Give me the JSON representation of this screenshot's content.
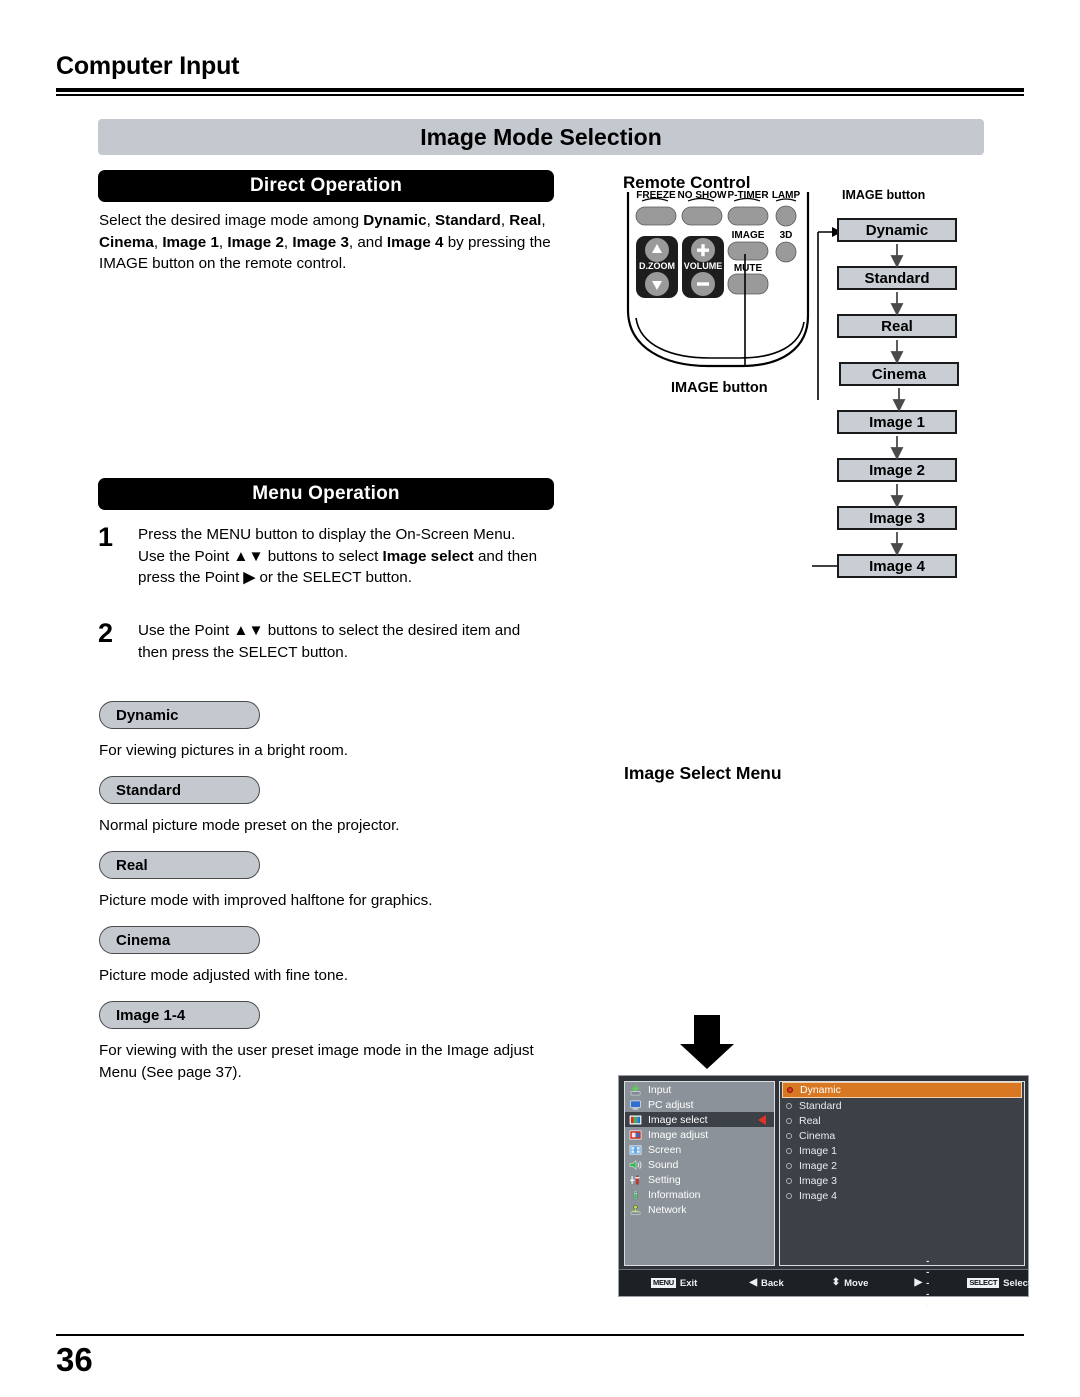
{
  "header": {
    "title": "Computer Input"
  },
  "section": {
    "title": "Image Mode Selection"
  },
  "direct_operation": {
    "heading": "Direct Operation",
    "body_prefix": "Select the desired image mode among ",
    "modes_inline": [
      "Dynamic",
      "Standard",
      "Real",
      "Cinema",
      "Image 1",
      "Image 2",
      "Image 3",
      "Image 4"
    ],
    "body_suffix": " by pressing the IMAGE button on the remote control."
  },
  "menu_operation": {
    "heading": "Menu Operation",
    "steps": [
      {
        "number": "1",
        "text_parts": [
          "Press the MENU button to display the On-Screen Menu. Use the Point ",
          "▲▼",
          " buttons to select ",
          "Image select",
          " and then press the Point ",
          "▶",
          " or the SELECT button."
        ]
      },
      {
        "number": "2",
        "text_parts": [
          "Use the Point ",
          "▲▼",
          " buttons to select the desired item and then press the SELECT button."
        ]
      }
    ]
  },
  "mode_descriptions": [
    {
      "chip": "Dynamic",
      "desc": "For viewing pictures in a bright room."
    },
    {
      "chip": "Standard",
      "desc": "Normal picture mode preset on the projector."
    },
    {
      "chip": "Real",
      "desc": "Picture mode with improved halftone for graphics."
    },
    {
      "chip": "Cinema",
      "desc": "Picture mode adjusted with fine tone."
    },
    {
      "chip": "Image 1-4",
      "desc": "For viewing with the user preset image mode in the Image adjust Menu (See page 37)."
    }
  ],
  "remote": {
    "title": "Remote Control",
    "label_top": "IMAGE button",
    "label_bottom": "IMAGE button",
    "buttons": [
      "FREEZE",
      "NO SHOW",
      "P-TIMER",
      "LAMP",
      "IMAGE",
      "3D",
      "D.ZOOM",
      "VOLUME",
      "MUTE"
    ]
  },
  "flow_chart": {
    "steps": [
      "Dynamic",
      "Standard",
      "Real",
      "Cinema",
      "Image 1",
      "Image 2",
      "Image 3",
      "Image 4"
    ],
    "box_color": "#c8ced3"
  },
  "osd": {
    "caption": "Image Select Menu",
    "sidebar": [
      {
        "label": "Input",
        "icon": "input-icon",
        "active": false
      },
      {
        "label": "PC adjust",
        "icon": "pc-adjust-icon",
        "active": false
      },
      {
        "label": "Image select",
        "icon": "image-select-icon",
        "active": true
      },
      {
        "label": "Image adjust",
        "icon": "image-adjust-icon",
        "active": false
      },
      {
        "label": "Screen",
        "icon": "screen-icon",
        "active": false
      },
      {
        "label": "Sound",
        "icon": "sound-icon",
        "active": false
      },
      {
        "label": "Setting",
        "icon": "setting-icon",
        "active": false
      },
      {
        "label": "Information",
        "icon": "information-icon",
        "active": false
      },
      {
        "label": "Network",
        "icon": "network-icon",
        "active": false
      }
    ],
    "options": [
      {
        "label": "Dynamic",
        "selected": true
      },
      {
        "label": "Standard",
        "selected": false
      },
      {
        "label": "Real",
        "selected": false
      },
      {
        "label": "Cinema",
        "selected": false
      },
      {
        "label": "Image 1",
        "selected": false
      },
      {
        "label": "Image 2",
        "selected": false
      },
      {
        "label": "Image 3",
        "selected": false
      },
      {
        "label": "Image 4",
        "selected": false
      }
    ],
    "statusbar": [
      {
        "badge": "MENU",
        "glyph": "",
        "label": "Exit"
      },
      {
        "badge": "",
        "glyph": "◀",
        "label": "Back"
      },
      {
        "badge": "",
        "glyph": "⬍",
        "label": "Move"
      },
      {
        "badge": "",
        "glyph": "▶",
        "label": "- - - - -"
      },
      {
        "badge": "SELECT",
        "glyph": "",
        "label": "Select"
      }
    ],
    "highlight_color": "#d97822",
    "sidebar_color": "#8b9299",
    "panel_color": "#3c4147"
  },
  "footer": {
    "page_number": "36"
  }
}
